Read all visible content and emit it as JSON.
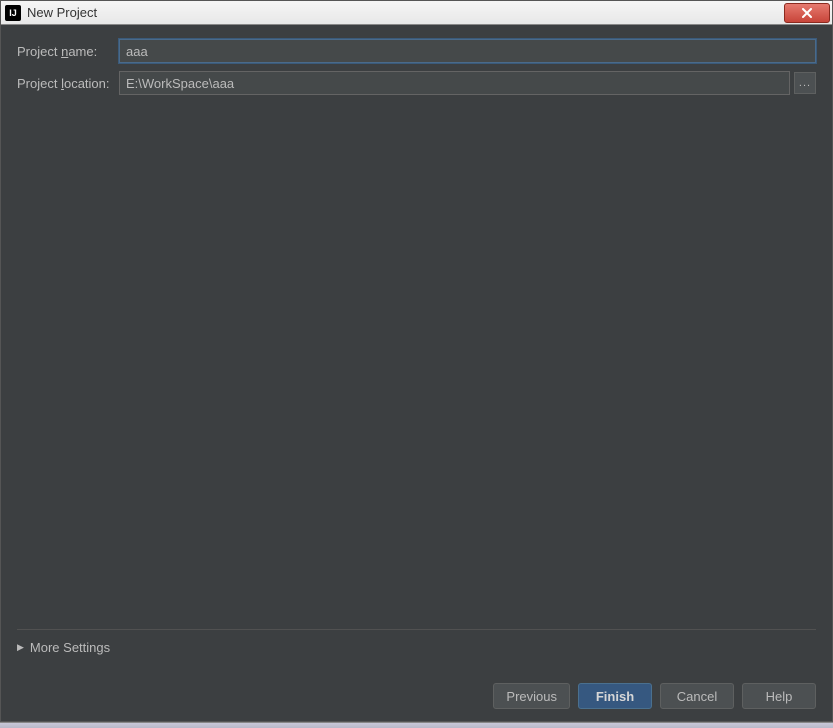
{
  "window": {
    "title": "New Project"
  },
  "form": {
    "project_name": {
      "label_pre": "Project ",
      "label_mnemonic": "n",
      "label_post": "ame:",
      "value": "aaa"
    },
    "project_location": {
      "label_pre": "Project ",
      "label_mnemonic": "l",
      "label_post": "ocation:",
      "value": "E:\\WorkSpace\\aaa"
    },
    "browse_label": "..."
  },
  "more_settings": {
    "label": "More Settings"
  },
  "buttons": {
    "previous": "Previous",
    "finish": "Finish",
    "cancel": "Cancel",
    "help": "Help"
  }
}
